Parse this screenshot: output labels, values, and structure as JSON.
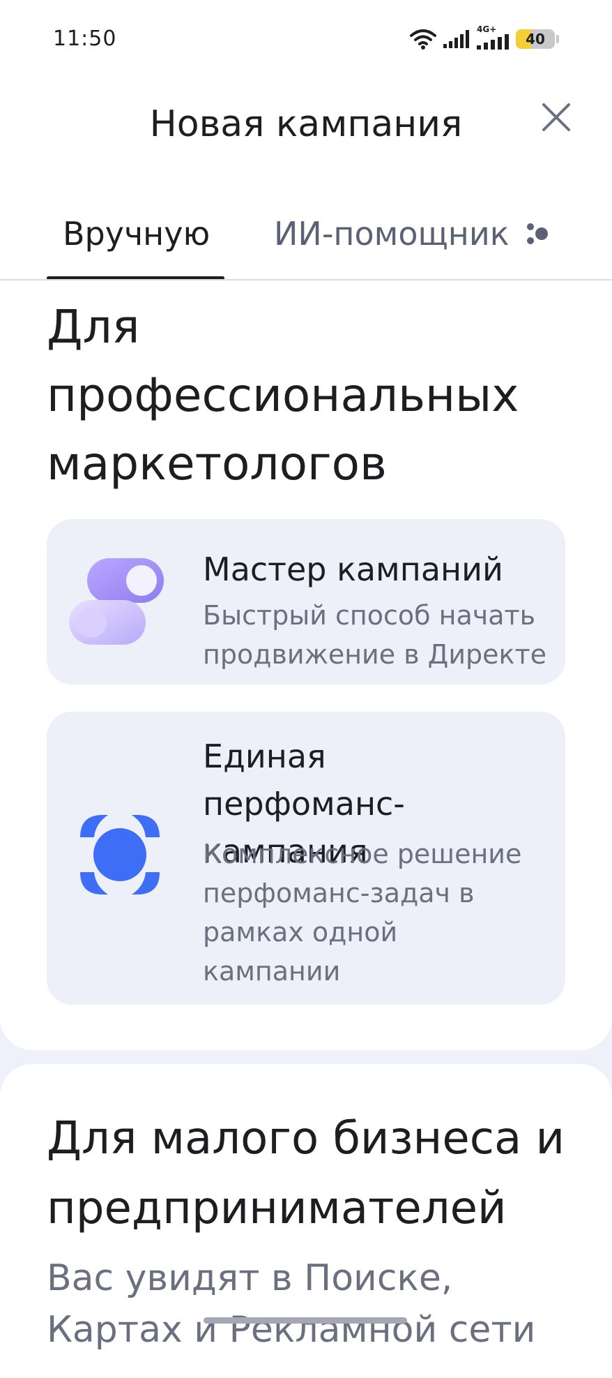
{
  "status_bar": {
    "time": "11:50",
    "network": "4G+",
    "battery": "40",
    "battery_level": 0.4
  },
  "header": {
    "title": "Новая кампания",
    "close_icon": "close-icon"
  },
  "tabs": [
    {
      "label": "Вручную",
      "active": true
    },
    {
      "label": "ИИ-помощник",
      "active": false,
      "icon": "ai-dots-icon"
    }
  ],
  "section_pro": {
    "title": "Для профессиональных маркетологов",
    "cards": [
      {
        "title": "Мастер кампаний",
        "description": "Быстрый способ начать продвижение в Директе",
        "icon": "toggle-switches-icon"
      },
      {
        "title": "Единая перфоманс-кампания",
        "description": "Комплексное решение перфоманс-задач в рамках одной кампании",
        "icon": "target-focus-icon"
      }
    ]
  },
  "section_small": {
    "title": "Для малого бизнеса и предпринимателей",
    "subtitle": "Вас увидят в Поиске, Картах и Рекламной сети"
  },
  "colors": {
    "accent_blue": "#3d6ef5",
    "accent_purple": "#9b8cf7",
    "card_bg": "#edf0f9",
    "text_primary": "#1d1d22",
    "text_secondary": "#6b7080"
  }
}
